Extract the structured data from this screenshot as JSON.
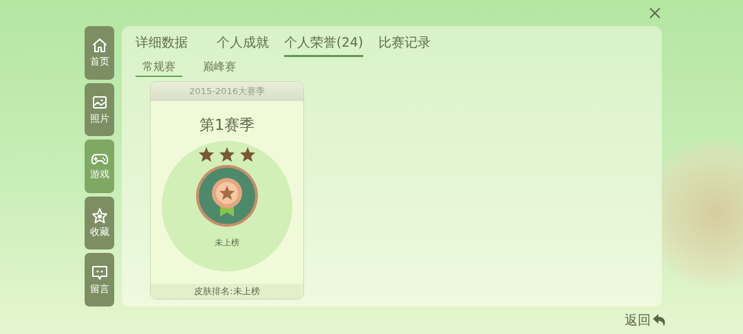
{
  "sidebar": {
    "items": [
      {
        "label": "首页",
        "selected": false
      },
      {
        "label": "照片",
        "selected": false
      },
      {
        "label": "游戏",
        "selected": true
      },
      {
        "label": "收藏",
        "selected": false
      },
      {
        "label": "留言",
        "selected": false
      }
    ]
  },
  "tabs": [
    {
      "label": "详细数据",
      "selected": false
    },
    {
      "label": "个人成就",
      "selected": false
    },
    {
      "label": "个人荣誉(24)",
      "selected": true
    },
    {
      "label": "比赛记录",
      "selected": false
    }
  ],
  "subtabs": [
    {
      "label": "常规赛",
      "selected": true
    },
    {
      "label": "巅峰赛",
      "selected": false
    }
  ],
  "cards": [
    {
      "season_group": "2015-2016大赛季",
      "title": "第1赛季",
      "stars": 3,
      "status": "未上榜",
      "skin_rank": "皮肤排名:未上榜"
    }
  ],
  "back_button": {
    "label": "返回"
  }
}
